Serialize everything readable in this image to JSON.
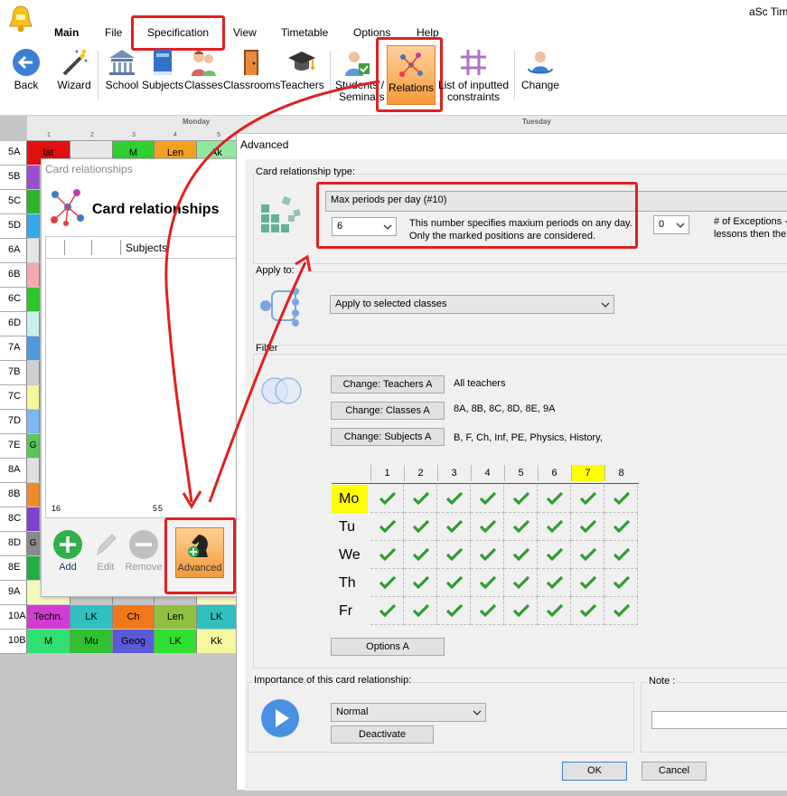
{
  "app": {
    "title": "aSc Tim"
  },
  "menu": {
    "tabs": [
      "Main",
      "File",
      "Specification",
      "View",
      "Timetable",
      "Options",
      "Help"
    ]
  },
  "toolbar": {
    "tools": [
      {
        "label": "Back",
        "icon": "back-arrow-icon"
      },
      {
        "label": "Wizard",
        "icon": "wand-icon"
      },
      {
        "label": "School",
        "icon": "school-building-icon"
      },
      {
        "label": "Subjects",
        "icon": "book-icon"
      },
      {
        "label": "Classes",
        "icon": "pupils-icon"
      },
      {
        "label": "Classrooms",
        "icon": "door-icon"
      },
      {
        "label": "Teachers",
        "icon": "graduation-cap-icon"
      },
      {
        "label": "Students /",
        "label2": "Seminars",
        "icon": "student-icon"
      },
      {
        "label": "Relations",
        "icon": "relations-icon"
      },
      {
        "label": "List of inputted",
        "label2": "constraints",
        "icon": "hash-grid-icon"
      },
      {
        "label": "Change",
        "icon": "change-user-icon"
      }
    ]
  },
  "timetable": {
    "days": [
      "Monday",
      "Tuesday"
    ],
    "periods": [
      "1",
      "2",
      "3",
      "4",
      "5"
    ],
    "classes": [
      "5A",
      "5B",
      "5C",
      "5D",
      "6A",
      "6B",
      "6C",
      "6D",
      "7A",
      "7B",
      "7C",
      "7D",
      "7E",
      "8A",
      "8B",
      "8C",
      "8D",
      "8E",
      "9A",
      "10A",
      "10B"
    ],
    "visible_cells": {
      "r0": [
        "lat",
        "",
        "M",
        "Len",
        "Ak"
      ],
      "r18": [
        "",
        "",
        "",
        "",
        "LK"
      ],
      "r19": [
        "Techn.",
        "LK",
        "Ch",
        "Len",
        "LK"
      ],
      "r20": [
        "M",
        "Mu",
        "Geog",
        "LK",
        "Kk"
      ],
      "r12": [
        "G",
        "",
        "",
        "",
        ""
      ],
      "r16": [
        "G",
        "",
        "",
        "",
        ""
      ]
    }
  },
  "card_window": {
    "caption": "Card relationships",
    "title": "Card relationships",
    "list_header": "Subjects",
    "list_row": {
      "num": "16",
      "v1": "5",
      "v2": "5"
    },
    "buttons": {
      "add": "Add",
      "edit": "Edit",
      "remove": "Remove",
      "advanced": "Advanced"
    }
  },
  "advanced": {
    "title": "Advanced",
    "type_group": "Card relationship type:",
    "type_value": "Max periods per day (#10)",
    "max_periods": "6",
    "max_periods_note_1": "This number specifies maxium periods on any day.",
    "max_periods_note_2": "Only the marked positions are considered.",
    "exceptions_value": "0",
    "exceptions_note_1": "# of Exceptions -",
    "exceptions_note_2": "lessons then the",
    "apply_group": "Apply to:",
    "apply_value": "Apply to selected classes",
    "filter_group": "Filter",
    "filter": {
      "teachers_btn": "Change: Teachers A",
      "teachers_val": "All teachers",
      "classes_btn": "Change: Classes A",
      "classes_val": "8A, 8B, 8C, 8D, 8E, 9A",
      "subjects_btn": "Change: Subjects A",
      "subjects_val": "B, F, Ch, Inf, PE, Physics, History,"
    },
    "grid": {
      "periods": [
        "1",
        "2",
        "3",
        "4",
        "5",
        "6",
        "7",
        "8"
      ],
      "days": [
        "Mo",
        "Tu",
        "We",
        "Th",
        "Fr"
      ],
      "highlight_period": "7",
      "highlight_day": "Mo"
    },
    "options_btn": "Options A",
    "importance_group": "Importance of this card relationship:",
    "importance_value": "Normal",
    "deactivate_btn": "Deactivate",
    "note_label": "Note :",
    "ok": "OK",
    "cancel": "Cancel"
  },
  "colors": {
    "highlight_red": "#e02020",
    "check_green": "#2e9e2e",
    "accent_orange": "#f59a3c",
    "yellow": "#ffff00"
  }
}
